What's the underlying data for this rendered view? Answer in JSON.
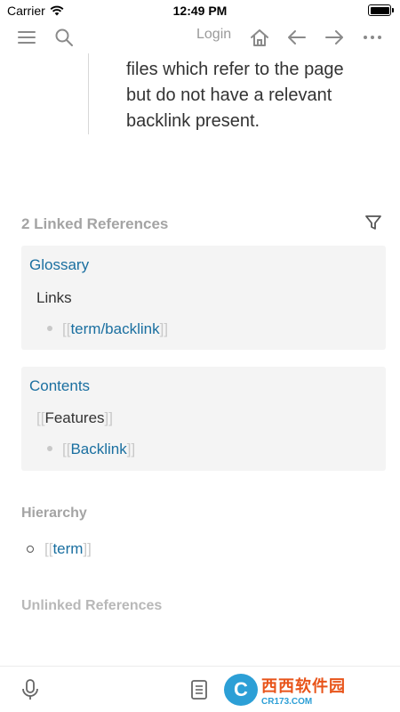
{
  "status_bar": {
    "carrier": "Carrier",
    "time": "12:49 PM"
  },
  "toolbar": {
    "login_label": "Login",
    "icons": [
      "menu-icon",
      "search-icon",
      "home-icon",
      "arrow-left-icon",
      "arrow-right-icon",
      "more-icon"
    ]
  },
  "quote": {
    "line1": "files which refer to the page",
    "line2": "but do not have a relevant",
    "line3": "backlink present."
  },
  "linked_references": {
    "title": "2 Linked References",
    "cards": [
      {
        "title": "Glossary",
        "parent": "Links",
        "child_link": "term/backlink"
      },
      {
        "title": "Contents",
        "parent_link": "Features",
        "child_link": "Backlink"
      }
    ]
  },
  "hierarchy": {
    "title": "Hierarchy",
    "item_link": "term"
  },
  "unlinked_references": {
    "title": "Unlinked References"
  },
  "bottom_bar": {
    "icons": [
      "microphone-icon",
      "document-icon"
    ]
  },
  "watermark": {
    "main": "西西软件园",
    "sub": "CR173.COM"
  },
  "colors": {
    "link": "#1a6fa0",
    "muted": "#a4a4a4",
    "card_bg": "#f4f4f4"
  }
}
